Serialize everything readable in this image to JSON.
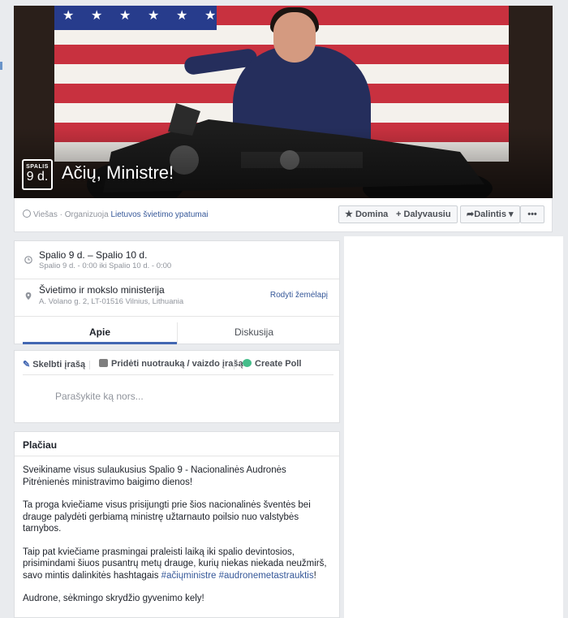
{
  "event": {
    "date_month": "SPALIS",
    "date_day": "9 d.",
    "title": "Ačių, Ministre!"
  },
  "header": {
    "visibility": "Viešas",
    "organizer_prefix": "· Organizuoja",
    "organizer": "Lietuvos švietimo ypatumai",
    "buttons": {
      "interested": "Domina",
      "going": "Dalyvausiu",
      "share": "Dalintis",
      "more": "•••"
    }
  },
  "details": {
    "time_title": "Spalio 9 d. – Spalio 10 d.",
    "time_sub": "Spalio 9 d. - 0:00 iki Spalio 10 d. - 0:00",
    "place_title": "Švietimo ir mokslo ministerija",
    "place_sub": "A. Volano g. 2, LT-01516 Vilnius, Lithuania",
    "map_link": "Rodyti žemėlapį",
    "tabs": [
      "Apie",
      "Diskusija"
    ]
  },
  "composer": {
    "post": "Skelbti įrašą",
    "photo": "Pridėti nuotrauką / vaizdo įrašą",
    "poll": "Create Poll",
    "placeholder": "Parašykite ką nors..."
  },
  "about": {
    "heading": "Plačiau",
    "p1": "Sveikiname visus sulaukusius Spalio 9 - Nacionalinės Audronės Pitrėnienės ministravimo baigimo dienos!",
    "p2": "Ta proga kviečiame visus prisijungti prie šios nacionalinės šventės bei drauge palydėti gerbiamą ministrę užtarnauto poilsio nuo valstybės tarnybos.",
    "p3_text": "Taip pat kviečiame prasmingai praleisti laiką iki spalio devintosios, prisimindami šiuos pusantrų metų drauge, kurių niekas niekada neužmirš, savo mintis dalinkitės hashtagais ",
    "hashtag1": "#ačiųministre",
    "hashtag2": "#audronemetastrauktis",
    "p3_end": "!",
    "p4": "Audrone, sėkmingo skrydžio gyvenimo kely!"
  },
  "colors": {
    "accent": "#4267b2",
    "link": "#365899",
    "flag_red": "#c8313f",
    "flag_blue": "#273c8c"
  },
  "icons": [
    "globe-icon",
    "star-icon",
    "plus-icon",
    "share-icon",
    "clock-icon",
    "pin-icon",
    "pencil-icon",
    "camera-icon",
    "poll-icon"
  ]
}
